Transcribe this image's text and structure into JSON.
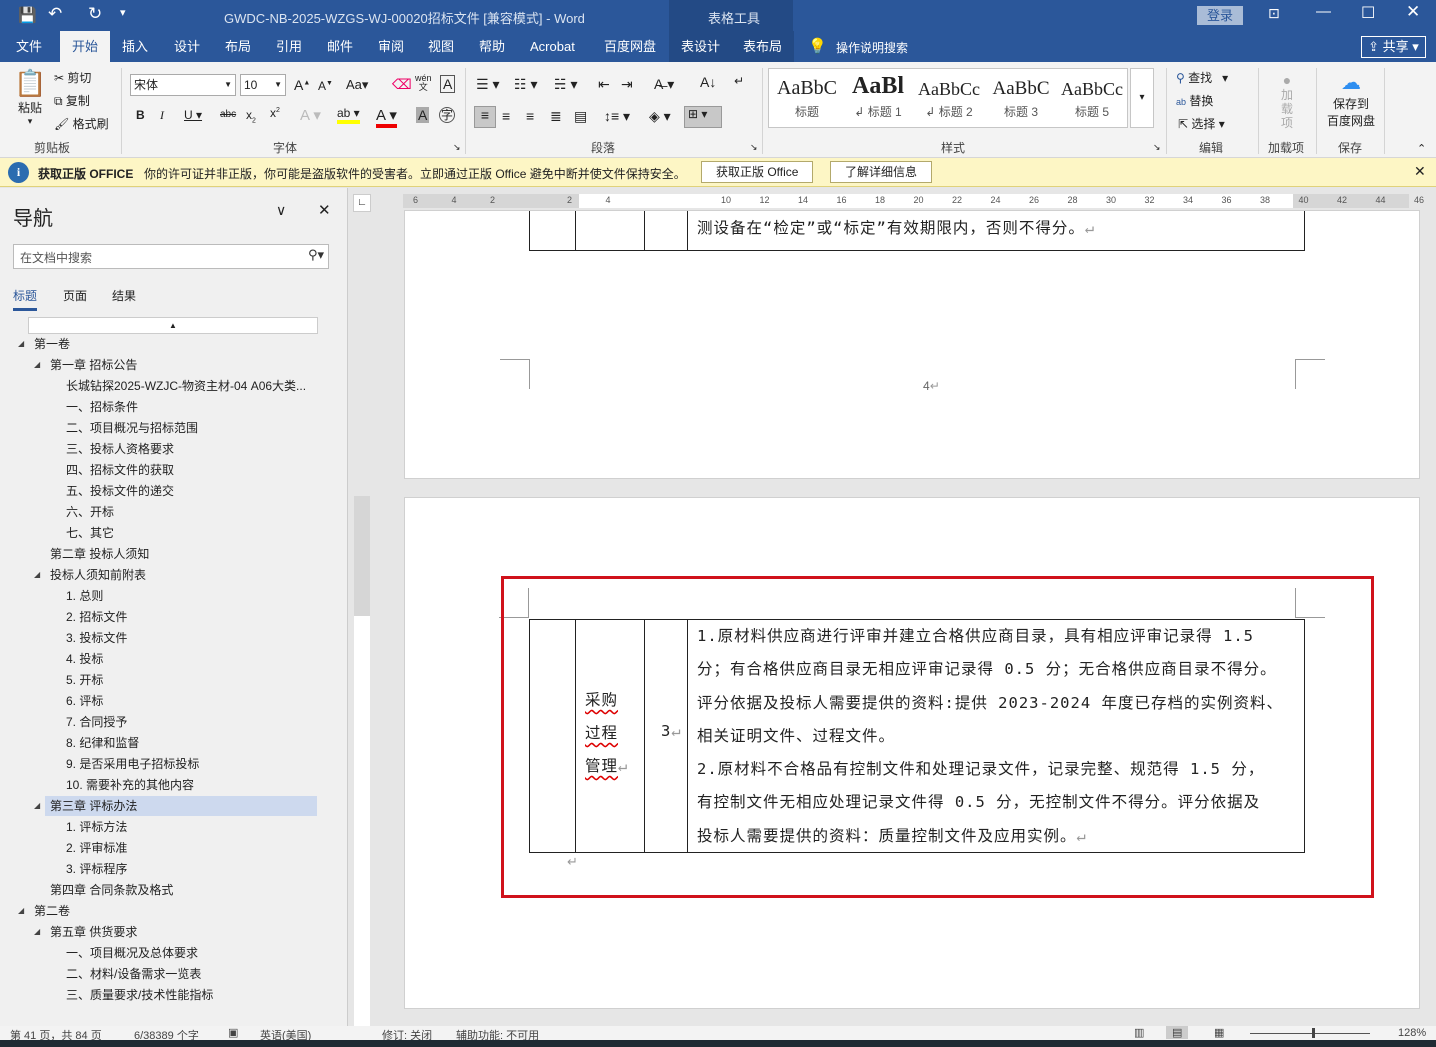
{
  "titlebar": {
    "title": "GWDC-NB-2025-WZGS-WJ-00020招标文件 [兼容模式]  -  Word",
    "context_tools": "表格工具",
    "login": "登录"
  },
  "tabs": [
    "文件",
    "开始",
    "插入",
    "设计",
    "布局",
    "引用",
    "邮件",
    "审阅",
    "视图",
    "帮助",
    "Acrobat",
    "百度网盘",
    "表设计",
    "表布局"
  ],
  "search_label": "操作说明搜索",
  "share": "共享",
  "ribbon": {
    "clipboard": {
      "paste": "粘贴",
      "cut": "剪切",
      "copy": "复制",
      "format_painter": "格式刷",
      "label": "剪贴板"
    },
    "font": {
      "name": "宋体",
      "size": "10",
      "label": "字体"
    },
    "paragraph": {
      "label": "段落"
    },
    "styles": {
      "items": [
        "标题",
        "标题 1",
        "标题 2",
        "标题 3",
        "标题 5"
      ],
      "preview": "AaBbC",
      "label": "样式"
    },
    "editing": {
      "find": "查找",
      "replace": "替换",
      "select": "选择",
      "label": "编辑"
    },
    "addins": {
      "btn": "加载项",
      "label": "加载项"
    },
    "save": {
      "btn1": "保存到",
      "btn2": "百度网盘",
      "label": "保存"
    }
  },
  "msgbar": {
    "title": "获取正版 OFFICE",
    "text": "你的许可证并非正版，你可能是盗版软件的受害者。立即通过正版 Office 避免中断并使文件保持安全。",
    "btn1": "获取正版 Office",
    "btn2": "了解详细信息"
  },
  "nav": {
    "title": "导航",
    "search_placeholder": "在文档中搜索",
    "tabs": [
      "标题",
      "页面",
      "结果"
    ],
    "items": [
      {
        "level": 0,
        "text": "第一卷",
        "exp": true
      },
      {
        "level": 1,
        "text": "第一章  招标公告",
        "exp": true
      },
      {
        "level": 2,
        "text": "长城钻探2025-WZJC-物资主材-04 A06大类..."
      },
      {
        "level": 2,
        "text": "一、招标条件"
      },
      {
        "level": 2,
        "text": "二、项目概况与招标范围"
      },
      {
        "level": 2,
        "text": "三、投标人资格要求"
      },
      {
        "level": 2,
        "text": "四、招标文件的获取"
      },
      {
        "level": 2,
        "text": "五、投标文件的递交"
      },
      {
        "level": 2,
        "text": "六、开标"
      },
      {
        "level": 2,
        "text": "七、其它"
      },
      {
        "level": 1,
        "text": "第二章  投标人须知"
      },
      {
        "level": 1,
        "text": "投标人须知前附表",
        "exp": true
      },
      {
        "level": 2,
        "text": "1. 总则"
      },
      {
        "level": 2,
        "text": "2. 招标文件"
      },
      {
        "level": 2,
        "text": "3. 投标文件"
      },
      {
        "level": 2,
        "text": "4. 投标"
      },
      {
        "level": 2,
        "text": "5. 开标"
      },
      {
        "level": 2,
        "text": "6. 评标"
      },
      {
        "level": 2,
        "text": "7. 合同授予"
      },
      {
        "level": 2,
        "text": "8. 纪律和监督"
      },
      {
        "level": 2,
        "text": "9. 是否采用电子招标投标"
      },
      {
        "level": 2,
        "text": "10. 需要补充的其他内容"
      },
      {
        "level": 1,
        "text": "第三章  评标办法",
        "exp": true,
        "selected": true
      },
      {
        "level": 2,
        "text": "1. 评标方法"
      },
      {
        "level": 2,
        "text": "2. 评审标准"
      },
      {
        "level": 2,
        "text": "3. 评标程序"
      },
      {
        "level": 1,
        "text": "第四章  合同条款及格式"
      },
      {
        "level": 0,
        "text": "第二卷",
        "exp": true
      },
      {
        "level": 1,
        "text": "第五章  供货要求",
        "exp": true
      },
      {
        "level": 2,
        "text": "一、项目概况及总体要求"
      },
      {
        "level": 2,
        "text": "二、材料/设备需求一览表"
      },
      {
        "level": 2,
        "text": "三、质量要求/技术性能指标"
      }
    ]
  },
  "doc": {
    "prev_line": "测设备在“检定”或“标定”有效期限内，否则不得分。",
    "page_number": "4",
    "row_name": [
      "采购",
      "过程",
      "管理"
    ],
    "score": "3",
    "lines": [
      "1.原材料供应商进行评审并建立合格供应商目录，具有相应评审记录得 1.5",
      "分；有合格供应商目录无相应评审记录得 0.5 分；无合格供应商目录不得分。",
      "评分依据及投标人需要提供的资料:提供 2023-2024 年度已存档的实例资料、",
      "相关证明文件、过程文件。",
      "2.原材料不合格品有控制文件和处理记录文件，记录完整、规范得 1.5 分，",
      "有控制文件无相应处理记录文件得 0.5 分，无控制文件不得分。评分依据及",
      "投标人需要提供的资料：质量控制文件及应用实例。"
    ],
    "highlight_color": "#d0121b"
  },
  "ruler_ticks": [
    "6",
    "4",
    "2",
    "",
    "2",
    "4",
    "",
    "",
    "10",
    "12",
    "14",
    "16",
    "18",
    "20",
    "22",
    "24",
    "26",
    "28",
    "30",
    "32",
    "34",
    "36",
    "38",
    "40",
    "42",
    "44",
    "46"
  ],
  "status": {
    "page": "第 41 页，共 84 页",
    "words": "6/38389 个字",
    "lang": "英语(美国)",
    "track": "修订: 关闭",
    "access": "辅助功能: 不可用",
    "zoom": "128%"
  }
}
